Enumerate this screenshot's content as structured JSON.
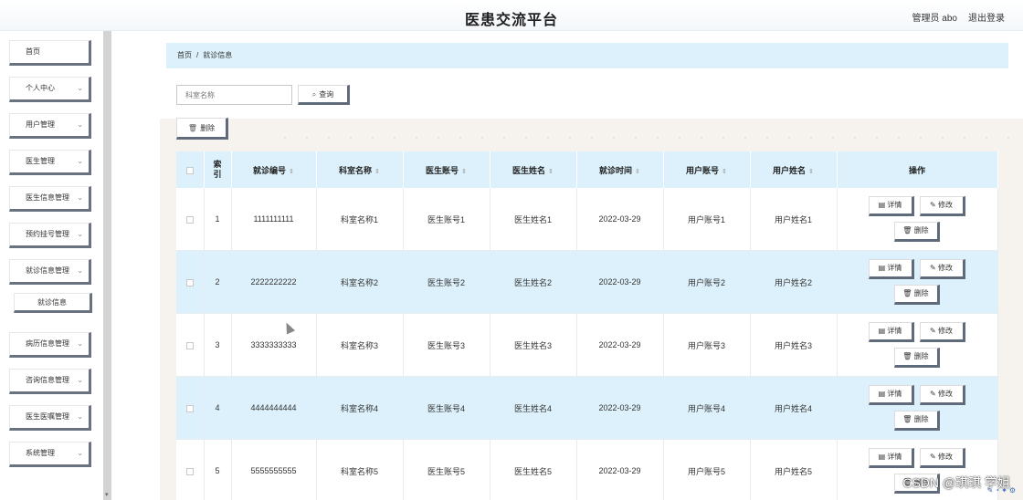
{
  "header": {
    "title": "医患交流平台",
    "admin": "管理员 abo",
    "logout": "退出登录"
  },
  "sidebar": {
    "items": [
      {
        "label": "首页",
        "chevron": false
      },
      {
        "label": "个人中心",
        "chevron": true
      },
      {
        "label": "用户管理",
        "chevron": true
      },
      {
        "label": "医生管理",
        "chevron": true
      },
      {
        "label": "医生信息管理",
        "chevron": true
      },
      {
        "label": "预约挂号管理",
        "chevron": true
      },
      {
        "label": "就诊信息管理",
        "chevron": true
      },
      {
        "label": "病历信息管理",
        "chevron": true
      },
      {
        "label": "咨询信息管理",
        "chevron": true
      },
      {
        "label": "医生医嘱管理",
        "chevron": true
      },
      {
        "label": "系统管理",
        "chevron": true
      }
    ],
    "sub_item": "就诊信息"
  },
  "breadcrumb": {
    "home": "首页",
    "sep": "/",
    "current": "就诊信息"
  },
  "search": {
    "placeholder": "科室名称",
    "button": "查询"
  },
  "toolbar": {
    "delete": "删除"
  },
  "table": {
    "headers": [
      "索引",
      "就诊编号",
      "科室名称",
      "医生账号",
      "医生姓名",
      "就诊时间",
      "用户账号",
      "用户姓名",
      "操作"
    ],
    "rows": [
      [
        "1",
        "1111111111",
        "科室名称1",
        "医生账号1",
        "医生姓名1",
        "2022-03-29",
        "用户账号1",
        "用户姓名1"
      ],
      [
        "2",
        "2222222222",
        "科室名称2",
        "医生账号2",
        "医生姓名2",
        "2022-03-29",
        "用户账号2",
        "用户姓名2"
      ],
      [
        "3",
        "3333333333",
        "科室名称3",
        "医生账号3",
        "医生姓名3",
        "2022-03-29",
        "用户账号3",
        "用户姓名3"
      ],
      [
        "4",
        "4444444444",
        "科室名称4",
        "医生账号4",
        "医生姓名4",
        "2022-03-29",
        "用户账号4",
        "用户姓名4"
      ],
      [
        "5",
        "5555555555",
        "科室名称5",
        "医生账号5",
        "医生姓名5",
        "2022-03-29",
        "用户账号5",
        "用户姓名5"
      ]
    ],
    "op_labels": {
      "detail": "详情",
      "edit": "修改",
      "delete": "删除"
    }
  },
  "watermark": "CSDN @琪琪 学姐"
}
